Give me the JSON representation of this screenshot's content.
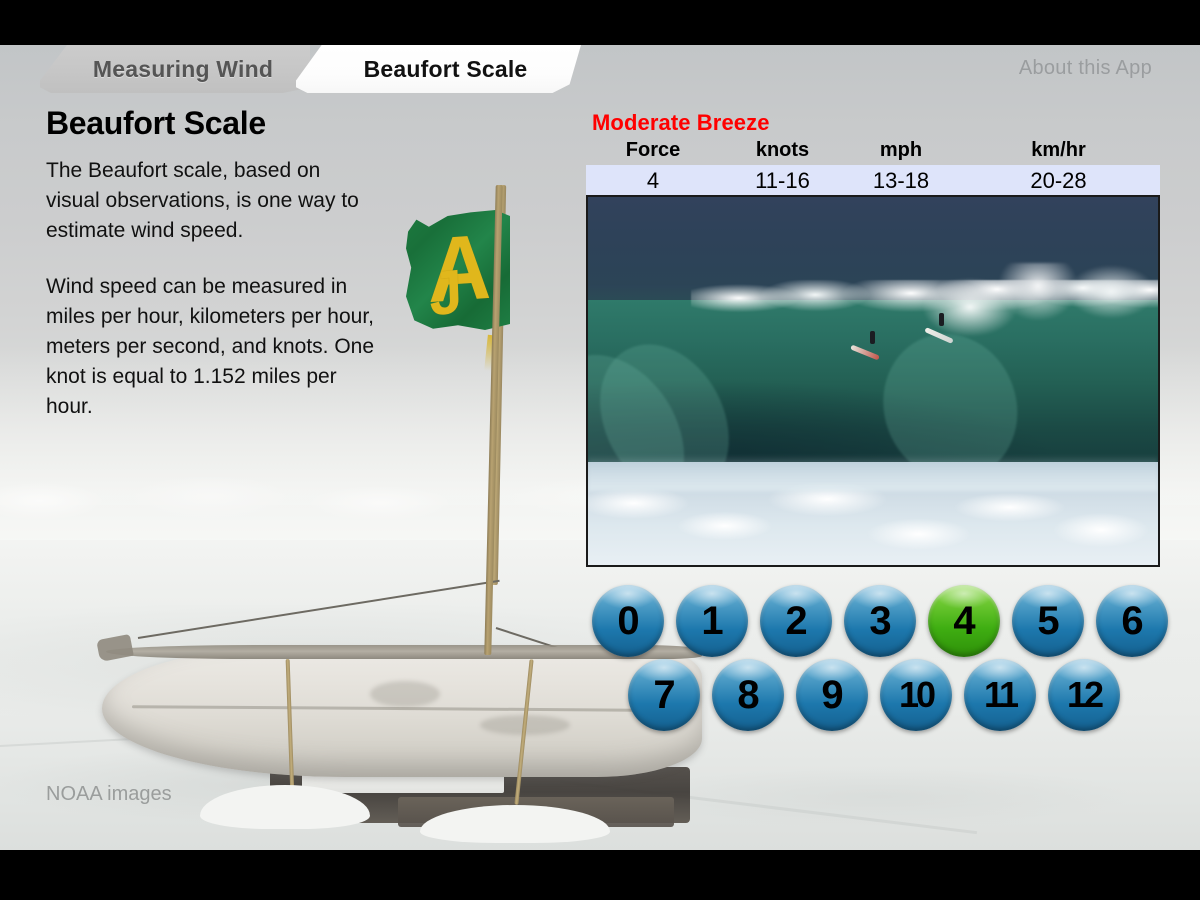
{
  "header": {
    "tabs": [
      {
        "label": "Measuring Wind",
        "active": false
      },
      {
        "label": "Beaufort Scale",
        "active": true
      }
    ],
    "about_label": "About this App"
  },
  "info": {
    "title": "Beaufort Scale",
    "paragraph_1": "The Beaufort scale, based on visual observations, is one way to estimate wind speed.",
    "paragraph_2": "Wind speed can be measured in miles per hour, kilometers per hour, meters per second, and knots. One knot is equal to 1.152 miles per hour."
  },
  "readout": {
    "name": "Moderate Breeze",
    "name_color": "#ff0000",
    "row_background": "#dee4fa",
    "columns": [
      "Force",
      "knots",
      "mph",
      "km/hr"
    ],
    "values": [
      "4",
      "11-16",
      "13-18",
      "20-28"
    ]
  },
  "wave_photo": {
    "caption": "surfers-riding-breaking-wave-photo",
    "sky_color": "#32425c",
    "wave_color": "#2a6f62",
    "foam_color": "#dde8ee"
  },
  "force_buttons": {
    "selected": "4",
    "selected_color": "#4fb81a",
    "default_color": "#1d78ad",
    "row_1": [
      "0",
      "1",
      "2",
      "3",
      "4",
      "5",
      "6"
    ],
    "row_2": [
      "7",
      "8",
      "9",
      "10",
      "11",
      "12"
    ]
  },
  "background": {
    "flag_letter": "A",
    "flag_letter_secondary": "J",
    "flag_color": "#1d7a3f",
    "flag_letter_color": "#e0b71c"
  },
  "credit": {
    "text": "NOAA images"
  }
}
